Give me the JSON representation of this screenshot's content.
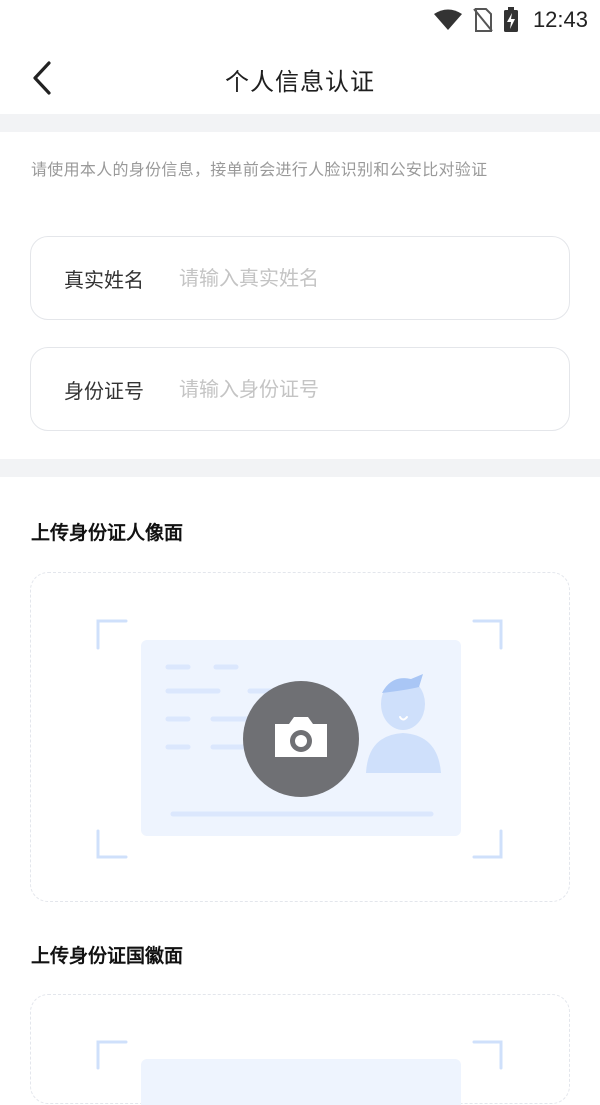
{
  "status_bar": {
    "time": "12:43",
    "icons": [
      "wifi-icon",
      "no-sim-icon",
      "battery-charging-icon"
    ]
  },
  "header": {
    "back_icon": "chevron-left-icon",
    "title": "个人信息认证"
  },
  "notice": "请使用本人的身份信息，接单前会进行人脸识别和公安比对验证",
  "form": {
    "name": {
      "label": "真实姓名",
      "placeholder": "请输入真实姓名",
      "value": ""
    },
    "id_number": {
      "label": "身份证号",
      "placeholder": "请输入身份证号",
      "value": ""
    }
  },
  "uploads": {
    "front": {
      "title": "上传身份证人像面",
      "icon": "camera-icon"
    },
    "back": {
      "title": "上传身份证国徽面",
      "icon": "camera-icon"
    }
  },
  "colors": {
    "accent_light": "#cfe0fb",
    "card_bg": "#eef4fe",
    "camera_circle": "#6f7074",
    "divider": "#f2f3f5",
    "placeholder": "#c4c4c4",
    "notice_text": "#9a9a9a"
  }
}
